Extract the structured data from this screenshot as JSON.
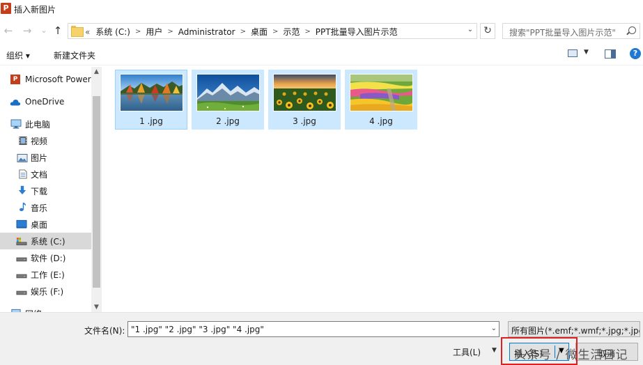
{
  "window": {
    "title": "插入新图片",
    "app_icon_letter": "P"
  },
  "nav": {
    "back_glyph": "←",
    "forward_glyph": "→",
    "recent_glyph": "⌄",
    "up_glyph": "↑"
  },
  "address": {
    "lead": "«",
    "crumbs": [
      "系统 (C:)",
      "用户",
      "Administrator",
      "桌面",
      "示范",
      "PPT批量导入图片示范"
    ],
    "refresh_glyph": "↻"
  },
  "search": {
    "placeholder": "搜索\"PPT批量导入图片示范\""
  },
  "toolbar": {
    "organize_label": "组织 ▾",
    "new_folder_label": "新建文件夹",
    "help_glyph": "?"
  },
  "sidebar": {
    "items": [
      {
        "label": "Microsoft Power",
        "icon": "powerpoint-icon"
      },
      {
        "label": "OneDrive",
        "icon": "cloud-icon"
      },
      {
        "label": "此电脑",
        "icon": "computer-icon"
      },
      {
        "label": "视频",
        "icon": "video-icon"
      },
      {
        "label": "图片",
        "icon": "pictures-icon"
      },
      {
        "label": "文档",
        "icon": "document-icon"
      },
      {
        "label": "下载",
        "icon": "download-icon"
      },
      {
        "label": "音乐",
        "icon": "music-icon"
      },
      {
        "label": "桌面",
        "icon": "desktop-icon"
      },
      {
        "label": "系统 (C:)",
        "icon": "system-drive-icon"
      },
      {
        "label": "软件 (D:)",
        "icon": "drive-icon"
      },
      {
        "label": "工作 (E:)",
        "icon": "drive-icon"
      },
      {
        "label": "娱乐 (F:)",
        "icon": "drive-icon"
      },
      {
        "label": "网络",
        "icon": "network-icon"
      }
    ]
  },
  "files": [
    {
      "name": "1 .jpg",
      "scene": "autumn-lake"
    },
    {
      "name": "2 .jpg",
      "scene": "mountain-meadow"
    },
    {
      "name": "3 .jpg",
      "scene": "sunflower-field"
    },
    {
      "name": "4 .jpg",
      "scene": "flower-garden"
    }
  ],
  "bottom": {
    "filename_label": "文件名(N):",
    "filename_value": "\"1 .jpg\" \"2 .jpg\" \"3 .jpg\" \"4 .jpg\"",
    "filter_value": "所有图片(*.emf;*.wmf;*.jpg;*.jpeg",
    "tools_label": "工具(L)",
    "insert_label": "插入(S)",
    "cancel_label": "取消"
  },
  "watermark": "头条号 / 微生活日记",
  "colors": {
    "selection": "#cce8ff",
    "accent": "#0078d7",
    "highlight": "#e02020"
  }
}
